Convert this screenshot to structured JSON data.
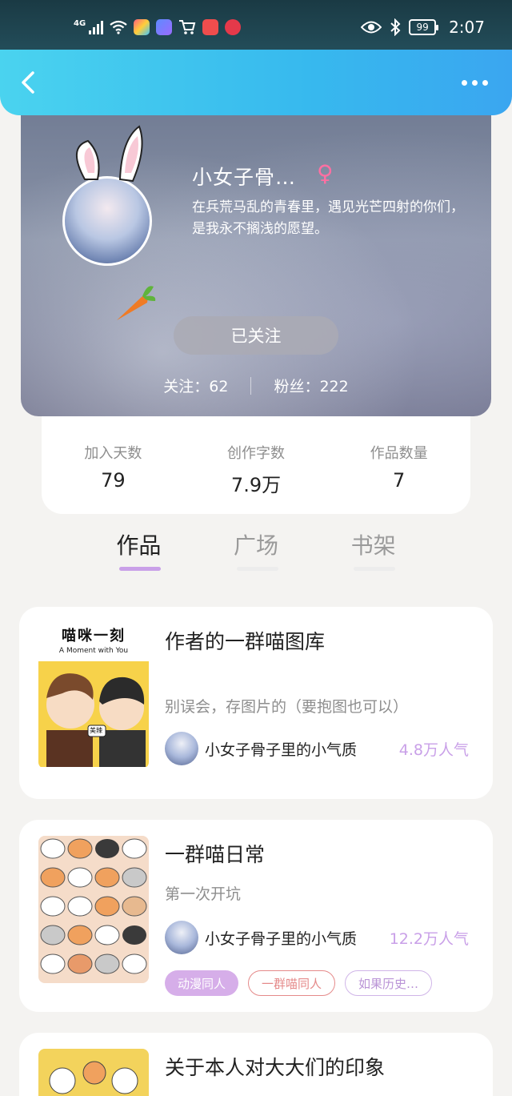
{
  "status_bar": {
    "network": "4G",
    "battery": "99",
    "time": "2:07"
  },
  "nav": {
    "back_icon": "chevron-left-icon",
    "more_icon": "more-horizontal-icon"
  },
  "profile": {
    "name": "小女子骨…",
    "gender_symbol": "♀",
    "bio": "在兵荒马乱的青春里，遇见光芒四射的你们，是我永不搁浅的愿望。",
    "follow_button": "已关注",
    "following": "关注：62",
    "followers": "粉丝：222"
  },
  "stats": [
    {
      "label": "加入天数",
      "value": "79"
    },
    {
      "label": "创作字数",
      "value": "7.9万"
    },
    {
      "label": "作品数量",
      "value": "7"
    }
  ],
  "tabs": [
    {
      "label": "作品",
      "active": true
    },
    {
      "label": "广场",
      "active": false
    },
    {
      "label": "书架",
      "active": false
    }
  ],
  "works": [
    {
      "cover_title": "喵咪一刻",
      "cover_subtitle": "A Moment with You",
      "cover_bubble": "美辣",
      "title": "作者的一群喵图库",
      "desc": "别误会，存图片的（要抱图也可以）",
      "author": "小女子骨子里的小气质",
      "popularity": "4.8万人气",
      "tags": []
    },
    {
      "title": "一群喵日常",
      "desc": "第一次开坑",
      "author": "小女子骨子里的小气质",
      "popularity": "12.2万人气",
      "tags": [
        "动漫同人",
        "一群喵同人",
        "如果历史…"
      ]
    },
    {
      "title": "关于本人对大大们的印象"
    }
  ],
  "colors": {
    "accent_purple": "#c9a0e8",
    "nav_blue": "#37b9ee",
    "tag_red": "#e58a8a"
  }
}
